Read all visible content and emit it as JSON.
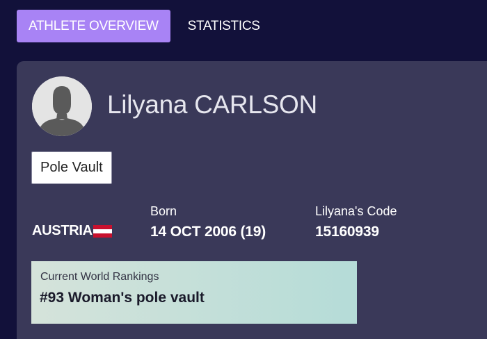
{
  "tabs": [
    {
      "label": "ATHLETE OVERVIEW",
      "active": true
    },
    {
      "label": "STATISTICS",
      "active": false
    }
  ],
  "athlete": {
    "name": "Lilyana CARLSON",
    "discipline": "Pole Vault",
    "country": "AUSTRIA",
    "born_label": "Born",
    "born_value": "14 OCT 2006 (19)",
    "code_label": "Lilyana's Code",
    "code_value": "15160939"
  },
  "rankings": {
    "label": "Current World Rankings",
    "value": "#93 Woman's pole vault"
  },
  "colors": {
    "background": "#12113a",
    "card": "#3a3959",
    "active_tab": "#a883f5"
  },
  "icons": {
    "avatar": "person-silhouette-icon",
    "flag": "austria-flag-icon"
  }
}
